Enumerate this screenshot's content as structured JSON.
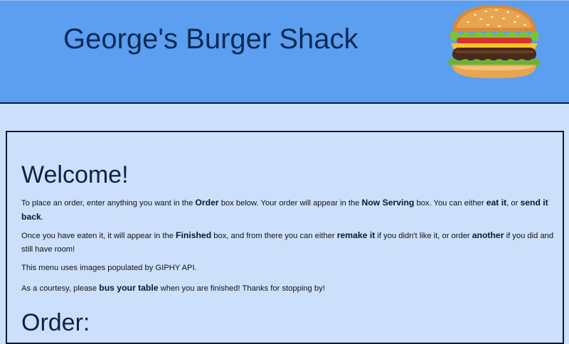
{
  "header": {
    "title": "George's Burger Shack",
    "logo_icon": "burger-icon",
    "background": "#5c9ef0",
    "title_color": "#0c2a55"
  },
  "welcome": {
    "heading": "Welcome!",
    "p1": {
      "t1": "To place an order, enter anything you want in the ",
      "b1": "Order",
      "t2": " box below. Your order will appear in the ",
      "b2": "Now Serving",
      "t3": " box. You can either ",
      "b3": "eat it",
      "t4": ", or ",
      "b4": "send it back",
      "t5": "."
    },
    "p2": {
      "t1": "Once you have eaten it, it will appear in the ",
      "b1": "Finished",
      "t2": " box, and from there you can either ",
      "b2": "remake it",
      "t3": " if you didn't like it, or order ",
      "b3": "another",
      "t4": " if you did and still have room!"
    },
    "p3": "This menu uses images populated by GIPHY API.",
    "p4": {
      "t1": "As a courtesy, please ",
      "b1": "bus your table",
      "t2": " when you are finished! Thanks for stopping by!"
    }
  },
  "order": {
    "heading": "Order:"
  },
  "colors": {
    "page_background": "#cce0fb",
    "border": "#0a1a33"
  }
}
